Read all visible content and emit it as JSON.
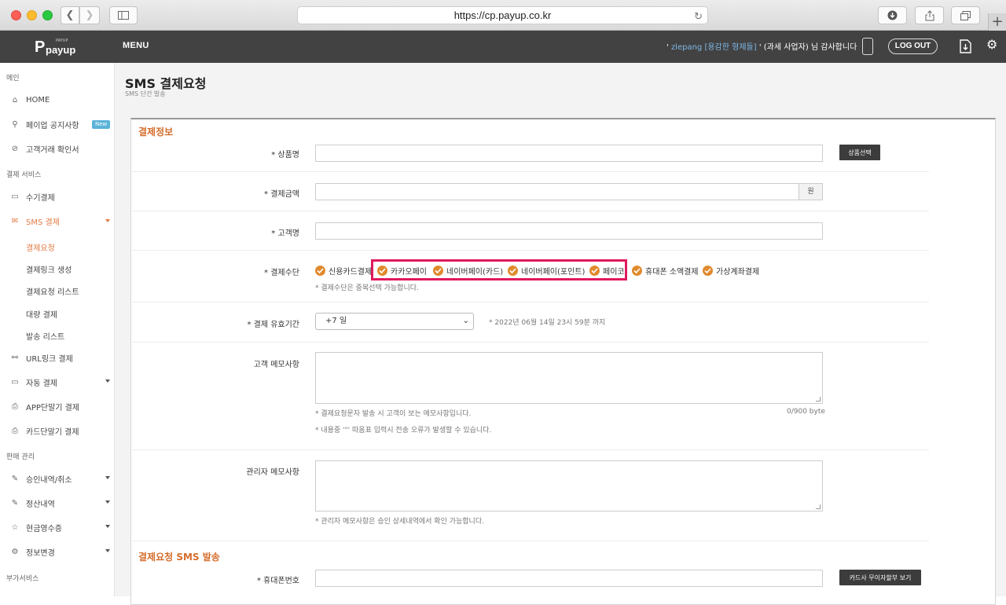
{
  "browser": {
    "url": "https://cp.payup.co.kr"
  },
  "header": {
    "logo": "payup",
    "logo_sup": "PAYUP",
    "menu_label": "MENU",
    "greeting_prefix": "' ",
    "greeting_user": "zlepang [용감한 형제들]",
    "greeting_suffix": " ' (과세 사업자) 님 감사합니다",
    "logout_label": "LOG OUT"
  },
  "sidebar": {
    "sections": [
      "메인",
      "결제 서비스",
      "판매 관리",
      "부가서비스"
    ],
    "items": [
      {
        "label": "HOME",
        "icon": "home-icon"
      },
      {
        "label": "페이업 공지사항",
        "icon": "pin-icon",
        "badge": "New"
      },
      {
        "label": "고객거래 확인서",
        "icon": "check-circle-icon"
      },
      {
        "label": "수기결제",
        "icon": "card-icon"
      },
      {
        "label": "SMS 결제",
        "icon": "mail-icon"
      },
      {
        "label": "URL링크 결제",
        "icon": "link-icon"
      },
      {
        "label": "자동 결제",
        "icon": "card-icon"
      },
      {
        "label": "APP단말기 결제",
        "icon": "printer-icon"
      },
      {
        "label": "카드단말기 결제",
        "icon": "printer-icon"
      },
      {
        "label": "승인내역/취소",
        "icon": "edit-icon"
      },
      {
        "label": "정산내역",
        "icon": "edit-icon"
      },
      {
        "label": "현금영수증",
        "icon": "star-icon"
      },
      {
        "label": "정보변경",
        "icon": "gear-icon"
      }
    ],
    "sms_sub": [
      "결제요청",
      "결제링크 생성",
      "결제요청 리스트",
      "대량 결제",
      "발송 리스트"
    ]
  },
  "page": {
    "title": "SMS 결제요청",
    "subtitle": "SMS 단건 발송"
  },
  "form": {
    "section1": "결제정보",
    "product_label": "* 상품명",
    "product_btn": "상품선택",
    "amount_label": "* 결제금액",
    "amount_unit": "원",
    "customer_label": "* 고객명",
    "method_label": "* 결제수단",
    "methods": [
      "신용카드결제",
      "카카오페이",
      "네이버페이(카드)",
      "네이버페이(포인트)",
      "페이코",
      "휴대폰 소액결제",
      "가상계좌결제"
    ],
    "method_hint": "* 결제수단은 중복선택 가능합니다.",
    "period_label": "* 결제 유효기간",
    "period_value": "+7 일",
    "period_hint": "* 2022년 06월 14일 23시 59분 까지",
    "memo_label": "고객 메모사항",
    "memo_hint1": "* 결제요청문자 발송 시 고객이 보는 메모사항입니다.",
    "memo_hint2": "* 내용중 '\"' 따옴표 입력시 전송 오류가 발생할 수 있습니다.",
    "memo_count": "0/900 byte",
    "admin_label": "관리자 메모사항",
    "admin_hint": "* 관리자 메모사항은 승인 상세내역에서 확인 가능합니다.",
    "section2": "결제요청 SMS 발송",
    "phone_label": "* 휴대폰번호",
    "card_btn": "카드사 무이자할부 보기"
  }
}
